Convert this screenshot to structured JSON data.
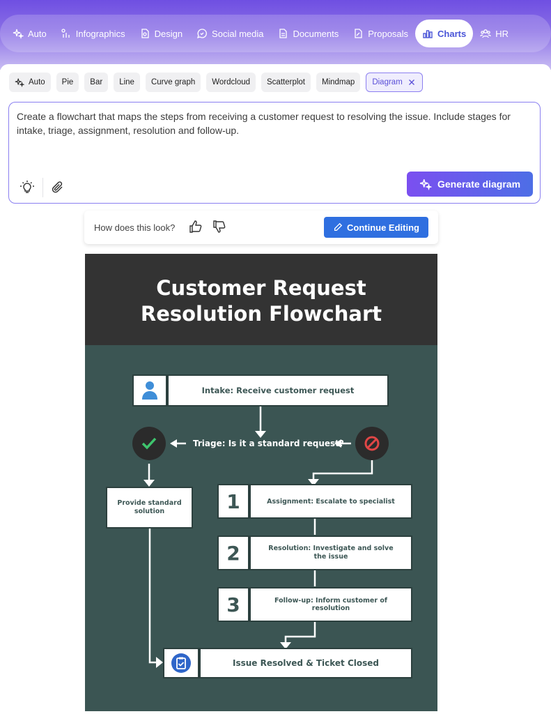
{
  "top_nav": {
    "items": [
      {
        "label": "Auto",
        "icon": "sparkles-icon"
      },
      {
        "label": "Infographics",
        "icon": "infographics-icon"
      },
      {
        "label": "Design",
        "icon": "design-icon"
      },
      {
        "label": "Social media",
        "icon": "chat-bubble-icon"
      },
      {
        "label": "Documents",
        "icon": "document-icon"
      },
      {
        "label": "Proposals",
        "icon": "proposal-icon"
      },
      {
        "label": "Charts",
        "icon": "bar-chart-icon",
        "active": true
      },
      {
        "label": "HR",
        "icon": "people-icon"
      }
    ]
  },
  "chart_types": {
    "items": [
      "Auto",
      "Pie",
      "Bar",
      "Line",
      "Curve graph",
      "Wordcloud",
      "Scatterplot",
      "Mindmap",
      "Diagram"
    ],
    "selected": "Diagram"
  },
  "prompt": {
    "text": "Create a flowchart that maps the steps from receiving a customer request to resolving the issue. Include stages for intake, triage, assignment, resolution and follow-up.",
    "generate_label": "Generate diagram"
  },
  "feedback": {
    "question": "How does this look?",
    "continue_label": "Continue Editing"
  },
  "flowchart": {
    "title_line1": "Customer Request",
    "title_line2": "Resolution Flowchart",
    "intake": "Intake: Receive customer request",
    "triage": "Triage: Is it a standard request?",
    "standard": "Provide standard solution",
    "steps": [
      {
        "num": "1",
        "label": "Assignment: Escalate to specialist"
      },
      {
        "num": "2",
        "label": "Resolution: Investigate and solve the issue"
      },
      {
        "num": "3",
        "label": "Follow-up: Inform customer of resolution"
      }
    ],
    "final": "Issue Resolved & Ticket Closed"
  },
  "colors": {
    "accent": "#6f4fe2",
    "button_blue": "#2f6fe0",
    "poster_header": "#333333",
    "poster_body": "#3b5553",
    "yes_green": "#3ec46d",
    "no_red": "#e04646"
  }
}
